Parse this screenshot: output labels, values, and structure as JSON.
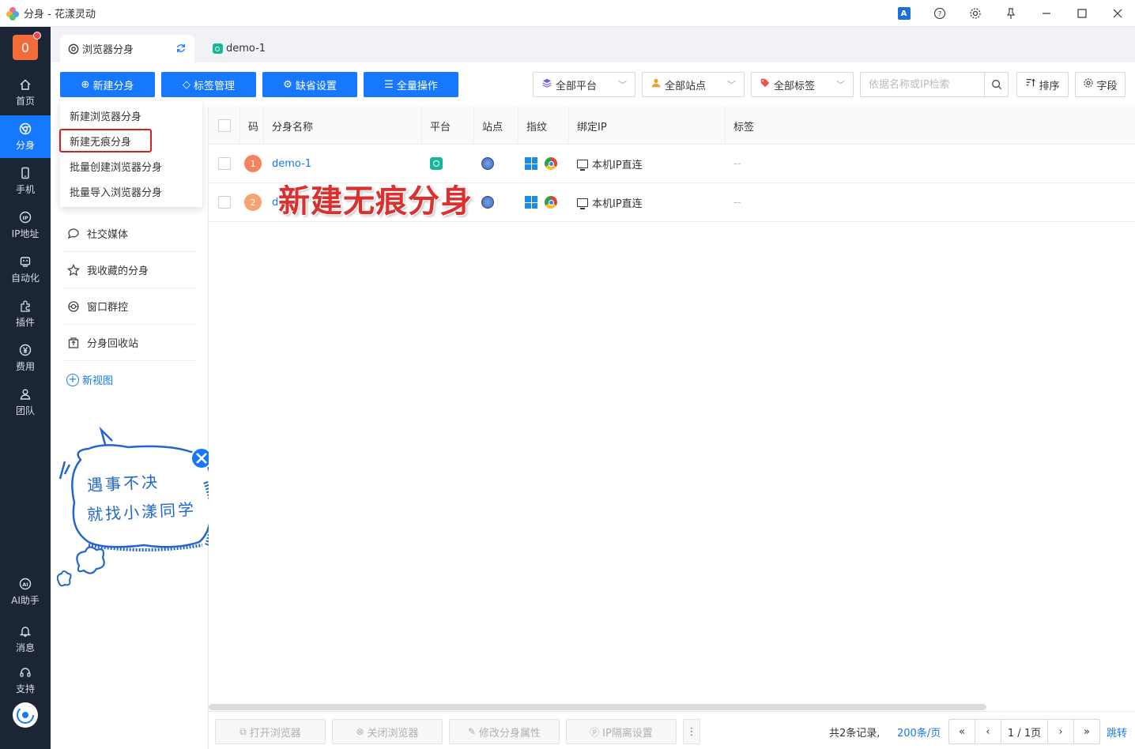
{
  "window": {
    "title": "分身 - 花漾灵动",
    "controls": [
      "translate",
      "help",
      "settings",
      "pin",
      "minimize",
      "maximize",
      "close"
    ]
  },
  "leftnav": {
    "badge_count": "0",
    "items": [
      {
        "label": "首页",
        "icon": "home-icon"
      },
      {
        "label": "分身",
        "icon": "browser-profile-icon",
        "active": true
      },
      {
        "label": "手机",
        "icon": "phone-icon"
      },
      {
        "label": "IP地址",
        "icon": "ip-icon"
      },
      {
        "label": "自动化",
        "icon": "automation-icon"
      },
      {
        "label": "插件",
        "icon": "plugin-icon"
      },
      {
        "label": "费用",
        "icon": "yen-icon"
      },
      {
        "label": "团队",
        "icon": "team-icon"
      }
    ],
    "bottom_items": [
      {
        "label": "AI助手",
        "icon": "ai-icon"
      },
      {
        "label": "消息",
        "icon": "bell-icon"
      },
      {
        "label": "支持",
        "icon": "headset-icon"
      }
    ]
  },
  "tabs": [
    {
      "label": "浏览器分身",
      "active": true
    },
    {
      "label": "demo-1",
      "active": false
    }
  ],
  "toolbar": {
    "new_profile": "新建分身",
    "tag_manage": "标签管理",
    "default_settings": "缺省设置",
    "bulk_ops": "全量操作",
    "platform_filter": "全部平台",
    "site_filter": "全部站点",
    "tag_filter": "全部标签",
    "search_placeholder": "依据名称或IP检索",
    "sort_label": "排序",
    "fields_label": "字段"
  },
  "dropdown": {
    "items": [
      "新建浏览器分身",
      "新建无痕分身",
      "批量创建浏览器分身",
      "批量导入浏览器分身"
    ],
    "highlighted_index": 1
  },
  "views": {
    "items": [
      "社交媒体",
      "我收藏的分身",
      "窗口群控",
      "分身回收站"
    ],
    "new_view": "新视图"
  },
  "promo": {
    "line1": "遇事不决",
    "line2": "就找小漾同学"
  },
  "table": {
    "columns": [
      "码",
      "分身名称",
      "平台",
      "站点",
      "指纹",
      "绑定IP",
      "标签"
    ],
    "rows": [
      {
        "num": "1",
        "name": "demo-1",
        "ip": "本机IP直连",
        "tag": "--"
      },
      {
        "num": "2",
        "name": "d",
        "ip": "本机IP直连",
        "tag": "--"
      }
    ]
  },
  "annotation_text": "新建无痕分身",
  "footer": {
    "open_browser": "打开浏览器",
    "close_browser": "关闭浏览器",
    "edit_props": "修改分身属性",
    "ip_isolation": "IP隔离设置",
    "total": "共2条记录,",
    "page_size": "200条/页",
    "page_info": "1 / 1页",
    "jump": "跳转"
  },
  "colors": {
    "primary": "#1677ff",
    "nav_bg": "#1b2536",
    "highlight_border": "#d42020",
    "annotation": "#d93030"
  }
}
